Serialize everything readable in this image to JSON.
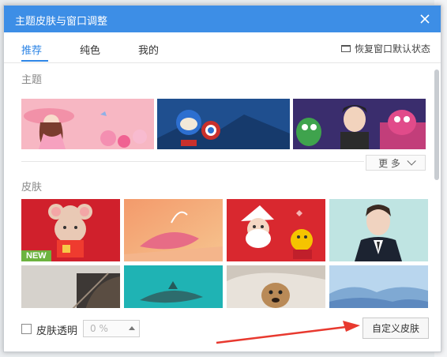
{
  "window": {
    "title": "主题皮肤与窗口调整"
  },
  "tabs": [
    {
      "label": "推荐",
      "active": true
    },
    {
      "label": "纯色",
      "active": false
    },
    {
      "label": "我的",
      "active": false
    }
  ],
  "restore_label": "恢复窗口默认状态",
  "sections": {
    "themes_label": "主题",
    "skins_label": "皮肤"
  },
  "more_label": "更 多",
  "new_badge": "NEW",
  "footer": {
    "transparent_label": "皮肤透明",
    "opacity_value": "0 %",
    "custom_skin_label": "自定义皮肤"
  },
  "colors": {
    "titlebar": "#3d8ee6",
    "accent": "#2f86e6",
    "annotation": "#e8392f"
  }
}
